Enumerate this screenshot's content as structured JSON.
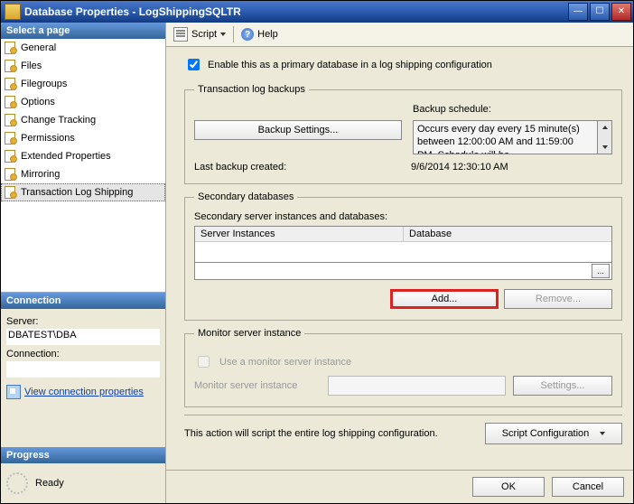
{
  "title": "Database Properties - LogShippingSQLTR",
  "sidebar": {
    "select_page_header": "Select a page",
    "items": [
      {
        "label": "General"
      },
      {
        "label": "Files"
      },
      {
        "label": "Filegroups"
      },
      {
        "label": "Options"
      },
      {
        "label": "Change Tracking"
      },
      {
        "label": "Permissions"
      },
      {
        "label": "Extended Properties"
      },
      {
        "label": "Mirroring"
      },
      {
        "label": "Transaction Log Shipping"
      }
    ],
    "connection_header": "Connection",
    "server_label": "Server:",
    "server_value": "DBATEST\\DBA",
    "connection_label": "Connection:",
    "connection_value": "",
    "view_props_link": "View connection properties",
    "progress_header": "Progress",
    "progress_status": "Ready"
  },
  "toolbar": {
    "script_label": "Script",
    "help_label": "Help"
  },
  "main": {
    "enable_label": "Enable this as a primary database in a log shipping configuration",
    "tlb_legend": "Transaction log backups",
    "backup_settings_btn": "Backup Settings...",
    "backup_schedule_label": "Backup schedule:",
    "backup_schedule_text": "Occurs every day every 15 minute(s) between 12:00:00 AM and 11:59:00 PM. Schedule will be",
    "last_backup_label": "Last backup created:",
    "last_backup_value": "9/6/2014 12:30:10 AM",
    "secondary_legend": "Secondary databases",
    "secondary_caption": "Secondary server instances and databases:",
    "col_server_instances": "Server Instances",
    "col_database": "Database",
    "browse_btn": "...",
    "add_btn": "Add...",
    "remove_btn": "Remove...",
    "monitor_legend": "Monitor server instance",
    "use_monitor_label": "Use a monitor server instance",
    "monitor_instance_label": "Monitor server instance",
    "settings_btn": "Settings...",
    "script_note": "This action will script the entire log shipping configuration.",
    "script_config_btn": "Script Configuration"
  },
  "footer": {
    "ok": "OK",
    "cancel": "Cancel"
  }
}
